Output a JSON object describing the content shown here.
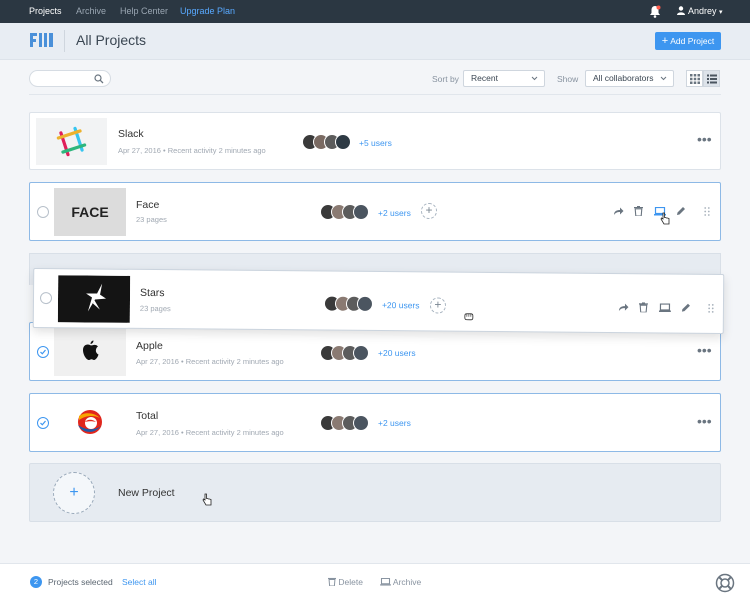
{
  "nav": {
    "links": [
      "Projects",
      "Archive",
      "Help Center",
      "Upgrade Plan"
    ],
    "user": "Andrey"
  },
  "header": {
    "title": "All Projects",
    "add_button": "Add Project"
  },
  "toolbar": {
    "search_placeholder": "",
    "sort_label": "Sort by",
    "sort_value": "Recent",
    "show_label": "Show",
    "show_value": "All collaborators"
  },
  "projects": [
    {
      "name": "Slack",
      "meta": "Apr 27, 2016  •  Recent activity 2 minutes ago",
      "users": "+5 users",
      "selected": false
    },
    {
      "name": "Face",
      "meta": "23 pages",
      "users": "+2 users",
      "selected": false,
      "thumb_text": "FACE"
    },
    {
      "name": "Stars",
      "meta": "23 pages",
      "users": "+20 users",
      "selected": false,
      "dragging": true
    },
    {
      "name": "Apple",
      "meta": "Apr 27, 2016  •  Recent activity 2 minutes ago",
      "users": "+20 users",
      "selected": true
    },
    {
      "name": "Total",
      "meta": "Apr 27, 2016  •  Recent activity 2 minutes ago",
      "users": "+2 users",
      "selected": true
    }
  ],
  "new_project": {
    "label": "New Project"
  },
  "bottom": {
    "count": "2",
    "selected_label": "Projects selected",
    "select_all": "Select all",
    "delete": "Delete",
    "archive": "Archive"
  },
  "colors": {
    "accent": "#3d96f0",
    "nav_bg": "#2b3742",
    "upgrade": "#58a9ff"
  }
}
